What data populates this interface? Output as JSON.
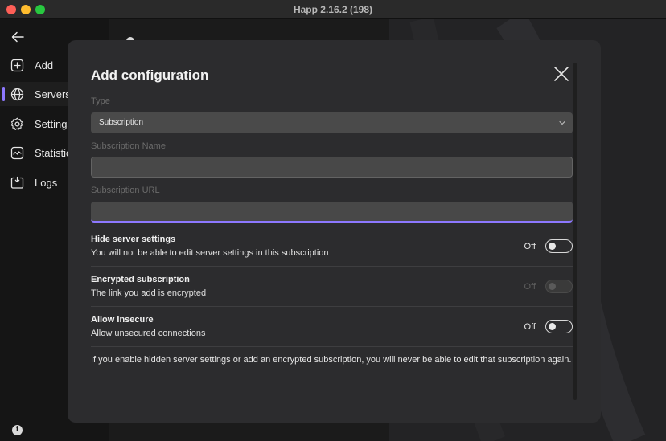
{
  "window": {
    "title": "Happ 2.16.2 (198)"
  },
  "sidebar": {
    "items": [
      {
        "label": "Add",
        "icon": "plus-square-icon"
      },
      {
        "label": "Servers",
        "icon": "globe-icon",
        "active": true
      },
      {
        "label": "Settings",
        "icon": "gear-icon"
      },
      {
        "label": "Statistic",
        "icon": "chart-icon"
      },
      {
        "label": "Logs",
        "icon": "logs-icon"
      }
    ],
    "info_badge": "i"
  },
  "modal": {
    "title": "Add configuration",
    "type_label": "Type",
    "type_value": "Subscription",
    "name_label": "Subscription Name",
    "name_value": "",
    "url_label": "Subscription URL",
    "url_value": "",
    "options": [
      {
        "title": "Hide server settings",
        "desc": "You will not be able to edit server settings in this subscription",
        "state": "Off",
        "enabled": true
      },
      {
        "title": "Encrypted subscription",
        "desc": "The link you add is encrypted",
        "state": "Off",
        "enabled": false
      },
      {
        "title": "Allow Insecure",
        "desc": "Allow unsecured connections",
        "state": "Off",
        "enabled": true
      }
    ],
    "note": "If you enable hidden server settings or add an encrypted subscription, you will never be able to edit that subscription again."
  },
  "colors": {
    "accent": "#8d78ff",
    "modal_bg": "#2c2c2e",
    "sidebar_bg": "#151515"
  }
}
